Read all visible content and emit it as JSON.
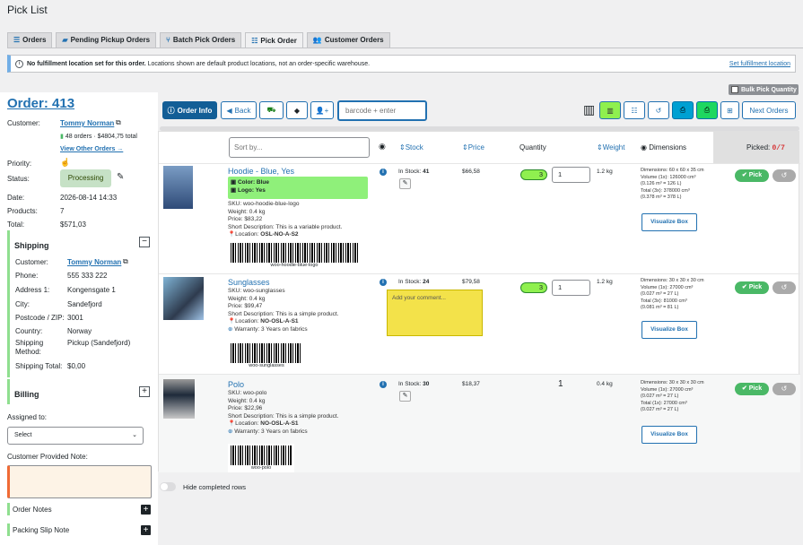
{
  "page_title": "Pick List",
  "tabs": [
    {
      "label": "Orders",
      "icon": "list-icon"
    },
    {
      "label": "Pending Pickup Orders",
      "icon": "truck-icon"
    },
    {
      "label": "Batch Pick Orders",
      "icon": "fork-icon"
    },
    {
      "label": "Pick Order",
      "icon": "checklist-icon"
    },
    {
      "label": "Customer Orders",
      "icon": "users-icon"
    }
  ],
  "notice": {
    "bold": "No fulfillment location set for this order.",
    "text": "Locations shown are default product locations, not an order-specific warehouse.",
    "link": "Set fulfillment location"
  },
  "bulk_pick_label": "Bulk Pick Quantity",
  "order": {
    "title": "Order: 413",
    "customer_label": "Customer:",
    "customer_name": "Tommy Norman",
    "orders_stat": "48 orders · $4804,75 total",
    "view_other": "View Other Orders →",
    "priority_label": "Priority:",
    "status_label": "Status:",
    "status_value": "Processing",
    "date_label": "Date:",
    "date_value": "2026-08-14 14:33",
    "products_label": "Products:",
    "products_value": "7",
    "total_label": "Total:",
    "total_value": "$571,03"
  },
  "shipping": {
    "heading": "Shipping",
    "customer_label": "Customer:",
    "customer_value": "Tommy Norman",
    "phone_label": "Phone:",
    "phone_value": "555 333 222",
    "address_label": "Address 1:",
    "address_value": "Kongensgate 1",
    "city_label": "City:",
    "city_value": "Sandefjord",
    "postcode_label": "Postcode / ZIP:",
    "postcode_value": "3001",
    "country_label": "Country:",
    "country_value": "Norway",
    "method_label": "Shipping Method:",
    "method_value": "Pickup (Sandefjord)",
    "total_label": "Shipping Total:",
    "total_value": "$0,00"
  },
  "billing": {
    "heading": "Billing"
  },
  "assigned": {
    "label": "Assigned to:",
    "select_value": "Select"
  },
  "customer_note_label": "Customer Provided Note:",
  "order_notes_label": "Order Notes",
  "packing_slip_label": "Packing Slip Note",
  "toolbar": {
    "order_info": "Order Info",
    "back": "Back",
    "barcode_placeholder": "barcode + enter",
    "next_orders": "Next Orders"
  },
  "table": {
    "sort_placeholder": "Sort by...",
    "col_stock": "Stock",
    "col_price": "Price",
    "col_quantity": "Quantity",
    "col_weight": "Weight",
    "col_dimensions": "Dimensions",
    "picked_label": "Picked:",
    "picked_value": "0/7"
  },
  "rows": [
    {
      "name": "Hoodie - Blue, Yes",
      "attr1": "Color: Blue",
      "attr2": "Logo: Yes",
      "sku": "SKU: woo-hoodie-blue-logo",
      "weight_line": "Weight: 0.4 kg",
      "price_line": "Price: $83,22",
      "short_desc": "Short Description: This is a variable product.",
      "location_label": "Location:",
      "location": "OSL-NO-A-S2",
      "barcode": "woo-hoodie-blue-logo",
      "stock_label": "In Stock:",
      "stock": "41",
      "price": "$66,58",
      "qty": "3",
      "qty_input": "1",
      "weight": "1.2 kg",
      "dims": [
        "Dimensions: 60 x 60 x 35 cm",
        "Volume (1x): 126000 cm³",
        "(0.126 m³ = 126 L)",
        "Total (3x): 378000 cm³",
        "(0.378 m³ = 378 L)"
      ],
      "visualize": "Visualize Box",
      "pick": "Pick"
    },
    {
      "name": "Sunglasses",
      "sku": "SKU: woo-sunglasses",
      "weight_line": "Weight: 0.4 kg",
      "price_line": "Price: $99,47",
      "short_desc": "Short Description: This is a simple product.",
      "location_label": "Location:",
      "location": "NO-OSL-A-S1",
      "warranty": "Warranty: 3 Years on fabrics",
      "barcode": "woo-sunglasses",
      "stock_label": "In Stock:",
      "stock": "24",
      "price": "$79,58",
      "comment_placeholder": "Add your comment...",
      "qty": "3",
      "qty_input": "1",
      "weight": "1.2 kg",
      "dims": [
        "Dimensions: 30 x 30 x 30 cm",
        "Volume (1x): 27000 cm³",
        "(0.027 m³ = 27 L)",
        "Total (3x): 81000 cm³",
        "(0.081 m³ = 81 L)"
      ],
      "visualize": "Visualize Box",
      "pick": "Pick"
    },
    {
      "name": "Polo",
      "sku": "SKU: woo-polo",
      "weight_line": "Weight: 0.4 kg",
      "price_line": "Price: $22,96",
      "short_desc": "Short Description: This is a simple product.",
      "location_label": "Location:",
      "location": "NO-OSL-A-S1",
      "warranty": "Warranty: 3 Years on fabrics",
      "barcode": "woo-polo",
      "stock_label": "In Stock:",
      "stock": "30",
      "price": "$18,37",
      "qty": "1",
      "weight": "0.4 kg",
      "dims": [
        "Dimensions: 30 x 30 x 30 cm",
        "Volume (1x): 27000 cm³",
        "(0.027 m³ = 27 L)",
        "Total (1x): 27000 cm³",
        "(0.027 m³ = 27 L)"
      ],
      "visualize": "Visualize Box",
      "pick": "Pick"
    }
  ],
  "hide_completed_label": "Hide completed rows"
}
